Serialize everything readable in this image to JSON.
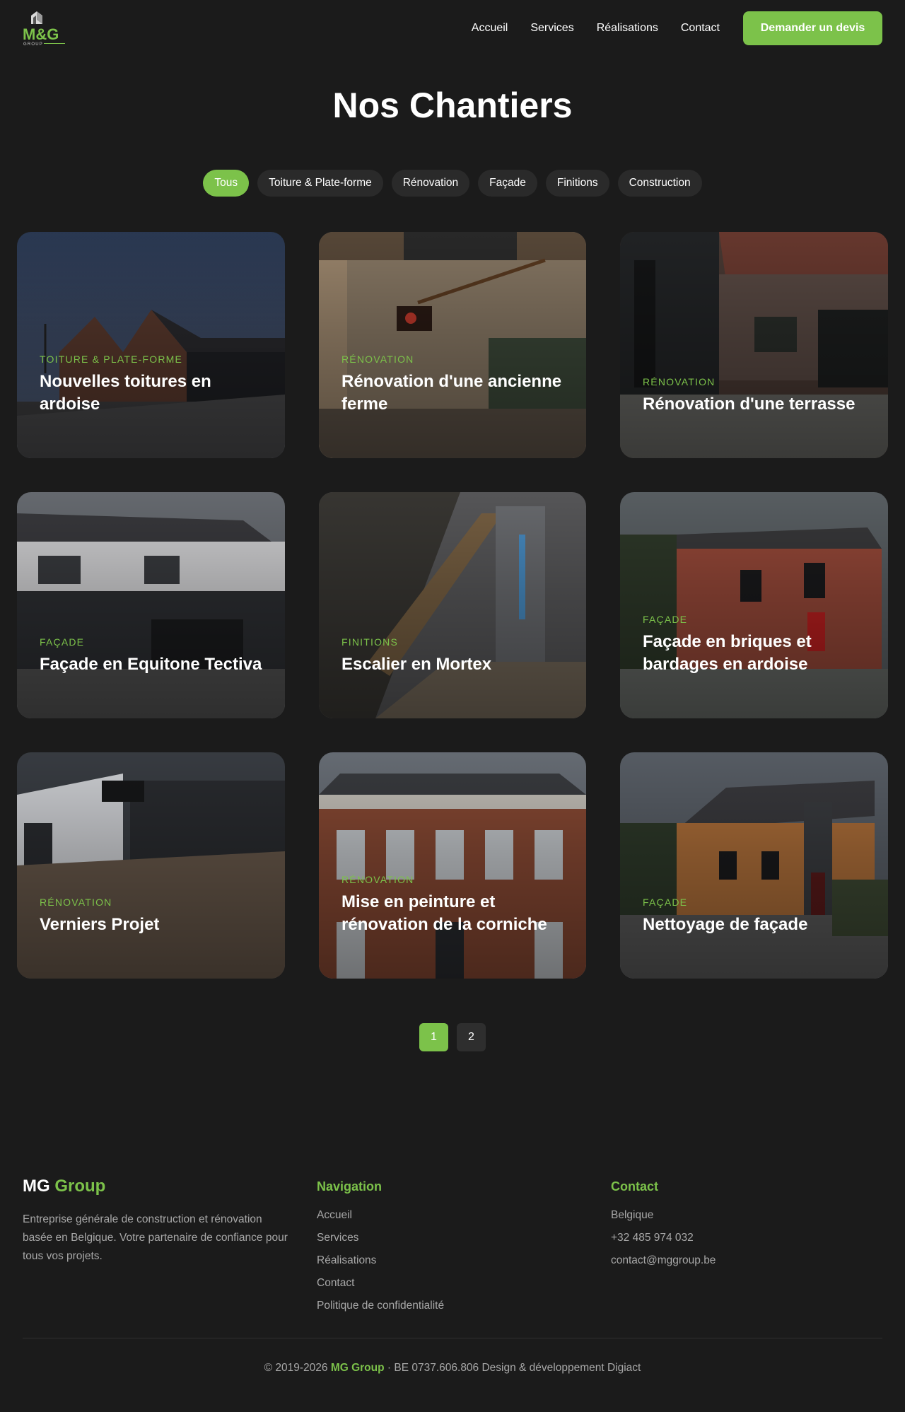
{
  "header": {
    "logo_text": "M&G",
    "logo_sub": "GROUP",
    "nav": [
      {
        "label": "Accueil"
      },
      {
        "label": "Services"
      },
      {
        "label": "Réalisations"
      },
      {
        "label": "Contact"
      }
    ],
    "cta_label": "Demander un devis"
  },
  "page_title": "Nos Chantiers",
  "filters": [
    {
      "label": "Tous",
      "active": true
    },
    {
      "label": "Toiture & Plate-forme",
      "active": false
    },
    {
      "label": "Rénovation",
      "active": false
    },
    {
      "label": "Façade",
      "active": false
    },
    {
      "label": "Finitions",
      "active": false
    },
    {
      "label": "Construction",
      "active": false
    }
  ],
  "projects": [
    {
      "category": "Toiture & Plate-forme",
      "title": "Nouvelles toitures en ardoise",
      "image": "slate-roof-houses"
    },
    {
      "category": "Rénovation",
      "title": "Rénovation d'une ancienne ferme",
      "image": "farmhouse-interior"
    },
    {
      "category": "Rénovation",
      "title": "Rénovation d'une terrasse",
      "image": "brick-house-terrace"
    },
    {
      "category": "Façade",
      "title": "Façade en Equitone Tectiva",
      "image": "modern-facade"
    },
    {
      "category": "Finitions",
      "title": "Escalier en Mortex",
      "image": "mortex-staircase"
    },
    {
      "category": "Façade",
      "title": "Façade en briques et bardages en ardoise",
      "image": "red-brick-house"
    },
    {
      "category": "Rénovation",
      "title": "Verniers Projet",
      "image": "open-interior"
    },
    {
      "category": "Rénovation",
      "title": "Mise en peinture et rénovation de la corniche",
      "image": "townhouse-facade"
    },
    {
      "category": "Façade",
      "title": "Nettoyage de façade",
      "image": "orange-house"
    }
  ],
  "pagination": [
    {
      "label": "1",
      "active": true
    },
    {
      "label": "2",
      "active": false
    }
  ],
  "footer": {
    "brand_a": "MG",
    "brand_b": "Group",
    "about": "Entreprise générale de construction et rénovation basée en Belgique. Votre partenaire de confiance pour tous vos projets.",
    "nav_title": "Navigation",
    "nav_links": [
      "Accueil",
      "Services",
      "Réalisations",
      "Contact",
      "Politique de confidentialité"
    ],
    "contact_title": "Contact",
    "contact_lines": [
      "Belgique",
      "+32 485 974 032",
      "contact@mggroup.be"
    ],
    "copyright_a": "© 2019-2026",
    "copyright_brand": "MG Group",
    "copyright_b": "· BE 0737.606.806 Design & développement Digiact"
  },
  "colors": {
    "accent": "#7cc24a",
    "background": "#1b1b1b",
    "chip": "#2a2a2a"
  }
}
